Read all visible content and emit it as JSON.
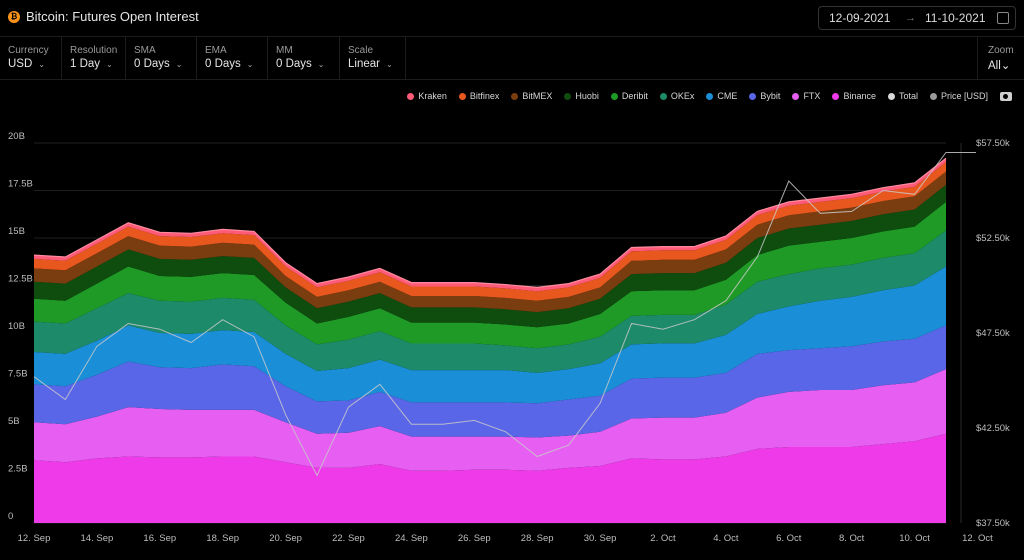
{
  "header": {
    "title": "Bitcoin: Futures Open Interest",
    "coin_icon": "bitcoin-icon",
    "date_from": "12-09-2021",
    "date_to": "11-10-2021",
    "arrow": "→"
  },
  "controls": [
    {
      "label": "Currency",
      "value": "USD"
    },
    {
      "label": "Resolution",
      "value": "1 Day"
    },
    {
      "label": "SMA",
      "value": "0 Days"
    },
    {
      "label": "EMA",
      "value": "0 Days"
    },
    {
      "label": "MM",
      "value": "0 Days"
    },
    {
      "label": "Scale",
      "value": "Linear"
    }
  ],
  "zoom": {
    "label": "Zoom",
    "value": "All"
  },
  "legend": [
    {
      "name": "Kraken",
      "color": "#ff5b79"
    },
    {
      "name": "Bitfinex",
      "color": "#e8581e"
    },
    {
      "name": "BitMEX",
      "color": "#7a3d10"
    },
    {
      "name": "Huobi",
      "color": "#0f4d0f"
    },
    {
      "name": "Deribit",
      "color": "#1f9a26"
    },
    {
      "name": "OKEx",
      "color": "#1d8a6a"
    },
    {
      "name": "CME",
      "color": "#1a8fd8"
    },
    {
      "name": "Bybit",
      "color": "#5a66e8"
    },
    {
      "name": "FTX",
      "color": "#e65ef2"
    },
    {
      "name": "Binance",
      "color": "#ee3ae8"
    },
    {
      "name": "Total",
      "color": "#d9d9d9"
    },
    {
      "name": "Price [USD]",
      "color": "#9a9a9a"
    }
  ],
  "chart_data": {
    "type": "area",
    "stacked": true,
    "x": [
      "12 Sep",
      "13 Sep",
      "14 Sep",
      "15 Sep",
      "16 Sep",
      "17 Sep",
      "18 Sep",
      "19 Sep",
      "20 Sep",
      "21 Sep",
      "22 Sep",
      "23 Sep",
      "24 Sep",
      "25 Sep",
      "26 Sep",
      "27 Sep",
      "28 Sep",
      "29 Sep",
      "30 Sep",
      "1 Oct",
      "2 Oct",
      "3 Oct",
      "4 Oct",
      "5 Oct",
      "6 Oct",
      "7 Oct",
      "8 Oct",
      "9 Oct",
      "10 Oct",
      "11 Oct"
    ],
    "x_tick_labels": [
      "12. Sep",
      "14. Sep",
      "16. Sep",
      "18. Sep",
      "20. Sep",
      "22. Sep",
      "24. Sep",
      "26. Sep",
      "28. Sep",
      "30. Sep",
      "2. Oct",
      "4. Oct",
      "6. Oct",
      "8. Oct",
      "10. Oct",
      "12. Oct"
    ],
    "y_left": {
      "ticks": [
        "0",
        "2.5B",
        "5B",
        "7.5B",
        "10B",
        "12.5B",
        "15B",
        "17.5B",
        "20B"
      ],
      "range": [
        0,
        20
      ]
    },
    "y_right": {
      "ticks": [
        "$37.50k",
        "$42.50k",
        "$47.50k",
        "$52.50k",
        "$57.50k"
      ],
      "range": [
        37500,
        57500
      ]
    },
    "series": [
      {
        "name": "Binance",
        "values": [
          3.3,
          3.2,
          3.4,
          3.5,
          3.45,
          3.45,
          3.5,
          3.5,
          3.2,
          2.9,
          2.9,
          3.1,
          2.75,
          2.75,
          2.8,
          2.8,
          2.75,
          2.9,
          3.0,
          3.4,
          3.35,
          3.35,
          3.5,
          3.9,
          4.0,
          4.0,
          4.0,
          4.15,
          4.3,
          4.7
        ]
      },
      {
        "name": "FTX",
        "values": [
          2.0,
          2.0,
          2.2,
          2.6,
          2.55,
          2.5,
          2.45,
          2.45,
          2.1,
          1.8,
          1.85,
          2.0,
          1.8,
          1.8,
          1.75,
          1.75,
          1.75,
          1.7,
          1.8,
          2.1,
          2.2,
          2.2,
          2.3,
          2.7,
          2.9,
          3.0,
          3.0,
          3.1,
          3.1,
          3.4
        ]
      },
      {
        "name": "Bybit",
        "values": [
          2.0,
          2.0,
          2.2,
          2.4,
          2.2,
          2.2,
          2.4,
          2.3,
          1.9,
          1.7,
          1.7,
          1.8,
          1.8,
          1.8,
          1.8,
          1.8,
          1.8,
          1.9,
          1.9,
          2.1,
          2.1,
          2.1,
          2.1,
          2.3,
          2.2,
          2.2,
          2.3,
          2.3,
          2.3,
          2.3
        ]
      },
      {
        "name": "CME",
        "values": [
          1.7,
          1.7,
          1.8,
          1.9,
          1.8,
          1.8,
          1.8,
          1.8,
          1.7,
          1.6,
          1.7,
          1.7,
          1.7,
          1.7,
          1.7,
          1.7,
          1.6,
          1.6,
          1.7,
          1.8,
          1.8,
          1.8,
          2.0,
          2.1,
          2.3,
          2.5,
          2.6,
          2.7,
          2.8,
          3.1
        ]
      },
      {
        "name": "OKEx",
        "values": [
          1.6,
          1.6,
          1.7,
          1.7,
          1.7,
          1.7,
          1.7,
          1.7,
          1.5,
          1.4,
          1.5,
          1.5,
          1.4,
          1.4,
          1.4,
          1.3,
          1.3,
          1.3,
          1.4,
          1.5,
          1.5,
          1.5,
          1.6,
          1.7,
          1.7,
          1.7,
          1.7,
          1.7,
          1.7,
          1.9
        ]
      },
      {
        "name": "Deribit",
        "values": [
          1.2,
          1.2,
          1.3,
          1.4,
          1.3,
          1.3,
          1.3,
          1.3,
          1.2,
          1.1,
          1.2,
          1.2,
          1.1,
          1.1,
          1.1,
          1.1,
          1.1,
          1.1,
          1.2,
          1.3,
          1.3,
          1.3,
          1.3,
          1.4,
          1.5,
          1.4,
          1.4,
          1.4,
          1.4,
          1.5
        ]
      },
      {
        "name": "Huobi",
        "values": [
          0.9,
          0.9,
          0.9,
          0.9,
          0.9,
          0.9,
          0.9,
          0.9,
          0.8,
          0.8,
          0.8,
          0.8,
          0.8,
          0.8,
          0.8,
          0.8,
          0.8,
          0.8,
          0.8,
          0.9,
          0.9,
          0.9,
          0.9,
          0.9,
          0.9,
          0.9,
          0.9,
          0.9,
          0.9,
          0.9
        ]
      },
      {
        "name": "BitMEX",
        "values": [
          0.7,
          0.7,
          0.7,
          0.7,
          0.7,
          0.7,
          0.7,
          0.7,
          0.6,
          0.6,
          0.6,
          0.6,
          0.6,
          0.6,
          0.6,
          0.6,
          0.6,
          0.6,
          0.6,
          0.7,
          0.7,
          0.7,
          0.7,
          0.7,
          0.7,
          0.7,
          0.7,
          0.7,
          0.7,
          0.7
        ]
      },
      {
        "name": "Bitfinex",
        "values": [
          0.5,
          0.5,
          0.5,
          0.5,
          0.5,
          0.5,
          0.5,
          0.5,
          0.5,
          0.5,
          0.5,
          0.5,
          0.5,
          0.5,
          0.5,
          0.5,
          0.5,
          0.5,
          0.5,
          0.5,
          0.5,
          0.5,
          0.5,
          0.5,
          0.5,
          0.5,
          0.5,
          0.5,
          0.5,
          0.5
        ]
      },
      {
        "name": "Kraken",
        "values": [
          0.2,
          0.2,
          0.2,
          0.2,
          0.2,
          0.2,
          0.2,
          0.2,
          0.2,
          0.2,
          0.2,
          0.2,
          0.2,
          0.2,
          0.2,
          0.2,
          0.2,
          0.2,
          0.2,
          0.2,
          0.2,
          0.2,
          0.2,
          0.2,
          0.2,
          0.2,
          0.2,
          0.2,
          0.2,
          0.2
        ]
      }
    ],
    "price": {
      "name": "Price [USD]",
      "values": [
        45200,
        44000,
        46800,
        48000,
        47700,
        47000,
        48200,
        47300,
        43200,
        40000,
        43600,
        44800,
        42700,
        42700,
        42900,
        42300,
        41000,
        41600,
        43800,
        48000,
        47700,
        48200,
        49200,
        51500,
        55500,
        53800,
        53900,
        55000,
        54800,
        57000
      ]
    },
    "ylabel": "",
    "xlabel": ""
  }
}
